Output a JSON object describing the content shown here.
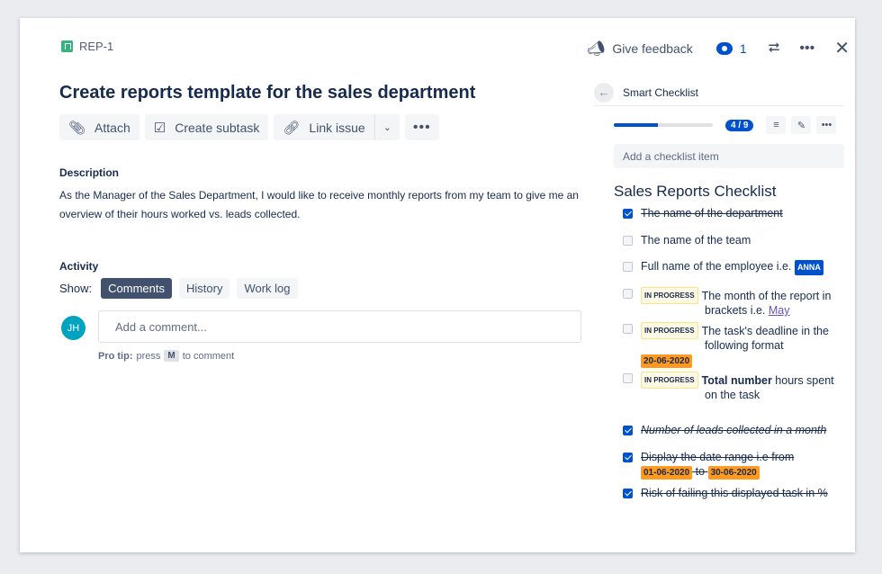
{
  "issue": {
    "key": "REP-1",
    "title": "Create reports template for the sales department",
    "actions": {
      "attach": "Attach",
      "create_subtask": "Create subtask",
      "link_issue": "Link issue"
    },
    "description_label": "Description",
    "description": "As the Manager of the Sales Department, I would like to receive monthly reports from my team to give me an overview of their hours worked vs. leads collected.",
    "activity_label": "Activity",
    "show_label": "Show:",
    "activity_tabs": [
      "Comments",
      "History",
      "Work log"
    ],
    "active_tab": "Comments",
    "avatar_initials": "JH",
    "comment_placeholder": "Add a comment...",
    "protip_label": "Pro tip:",
    "protip_pre": "press",
    "protip_key": "M",
    "protip_post": "to comment"
  },
  "header": {
    "feedback": "Give feedback",
    "watchers": "1"
  },
  "checklist": {
    "panel_title": "Smart Checklist",
    "progress_label": "4 / 9",
    "progress_done": 4,
    "progress_total": 9,
    "add_placeholder": "Add a checklist item",
    "title": "Sales Reports Checklist",
    "items": [
      {
        "text": "The name of the department"
      },
      {
        "text": "The name of the team"
      },
      {
        "text": "Full name of the employee i.e.",
        "tag": "ANNA"
      },
      {
        "status": "IN PROGRESS",
        "text": "The month of the report in",
        "text2": "brackets i.e.",
        "link": "May"
      },
      {
        "status": "IN PROGRESS",
        "text": "The task's deadline in the",
        "text2": "following format",
        "date": "20-06-2020"
      },
      {
        "status": "IN PROGRESS",
        "bold": "Total number",
        "text": " hours spent",
        "text2": "on the task"
      },
      {
        "text": "Number of leads collected in a month"
      },
      {
        "text": "Display the date range i.e from",
        "date1": "01-06-2020",
        "joiner": "to",
        "date2": "30-06-2020"
      },
      {
        "text": "Risk of failing this displayed task in %"
      }
    ]
  },
  "colors": {
    "accent": "#0052cc",
    "progress_green": "#36b37e",
    "date_tag": "#ff991f"
  },
  "icons": [
    "story-icon",
    "paperclip-icon",
    "subtask-icon",
    "link-icon",
    "chevron-down-icon",
    "more-icon",
    "megaphone-icon",
    "eye-icon",
    "share-icon",
    "close-icon",
    "arrow-left-icon",
    "filter-icon",
    "pencil-icon"
  ]
}
